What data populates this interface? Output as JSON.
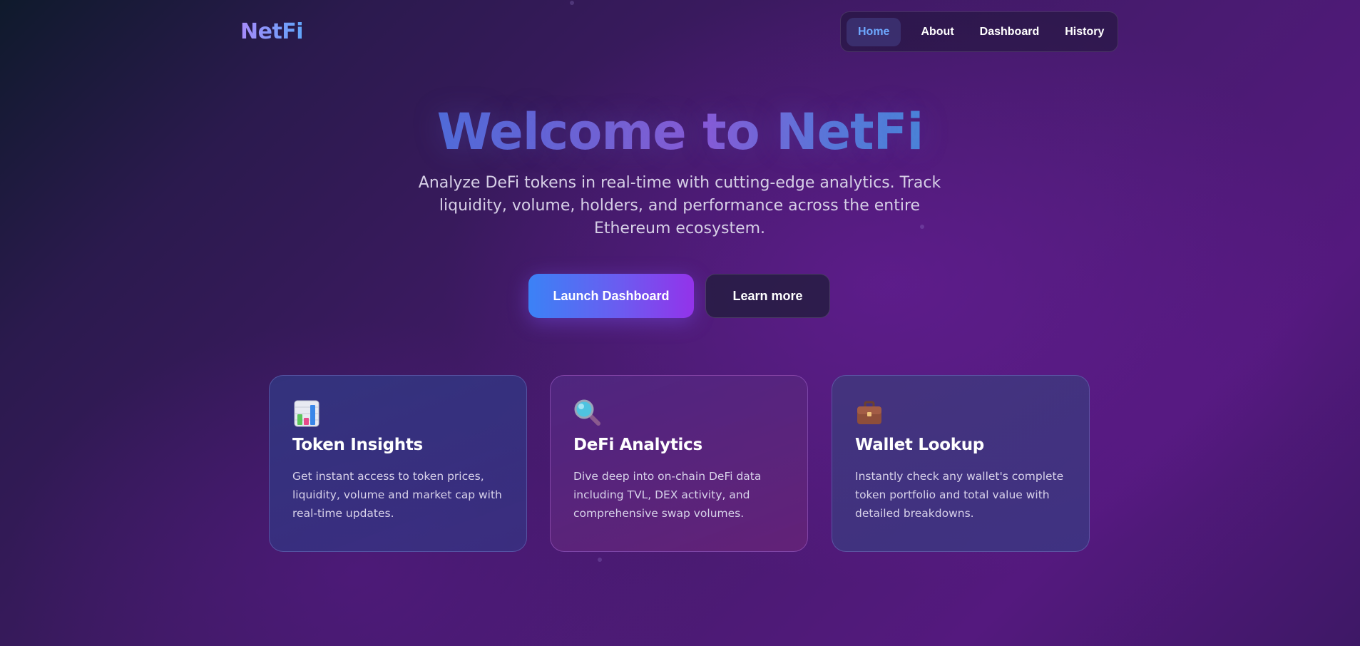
{
  "header": {
    "brand": "NetFi",
    "nav": [
      {
        "label": "Home",
        "active": true
      },
      {
        "label": "About"
      },
      {
        "label": "Dashboard"
      },
      {
        "label": "History"
      }
    ]
  },
  "hero": {
    "title": "Welcome to NetFi",
    "subtitle": "Analyze DeFi tokens in real-time with cutting-edge analytics. Track liquidity, volume, holders, and performance across the entire Ethereum ecosystem.",
    "primary_button": "Launch Dashboard",
    "secondary_button": "Learn more"
  },
  "features": [
    {
      "icon": "bar-chart-icon",
      "title": "Token Insights",
      "text": "Get instant access to token prices, liquidity, volume and market cap with real-time updates."
    },
    {
      "icon": "magnifying-glass-icon",
      "title": "DeFi Analytics",
      "text": "Dive deep into on-chain DeFi data including TVL, DEX activity, and comprehensive swap volumes."
    },
    {
      "icon": "briefcase-icon",
      "title": "Wallet Lookup",
      "text": "Instantly check any wallet's complete token portfolio and total value with detailed breakdowns."
    }
  ],
  "colors": {
    "accent_blue": "#3b82f6",
    "accent_purple": "#9333ea",
    "active_nav_text": "#6ea8ff"
  }
}
